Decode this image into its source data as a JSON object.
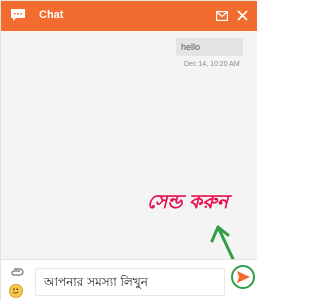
{
  "header": {
    "title": "Chat",
    "brand_color": "#f26b2f",
    "icons": [
      "chat-bubble-icon",
      "mail-icon",
      "close-icon"
    ]
  },
  "messages": [
    {
      "text": "hello",
      "timestamp": "Dec 14, 10:20 AM"
    }
  ],
  "annotation": {
    "text": "সেন্ড করুন",
    "color": "#e8104f",
    "arrow_color": "#2f9e44"
  },
  "composer": {
    "input_text": "আপনার সমস্যা লিখুন",
    "icons": [
      "attach-icon",
      "emoji-icon",
      "send-icon"
    ],
    "send_color": "#f26b2f"
  }
}
